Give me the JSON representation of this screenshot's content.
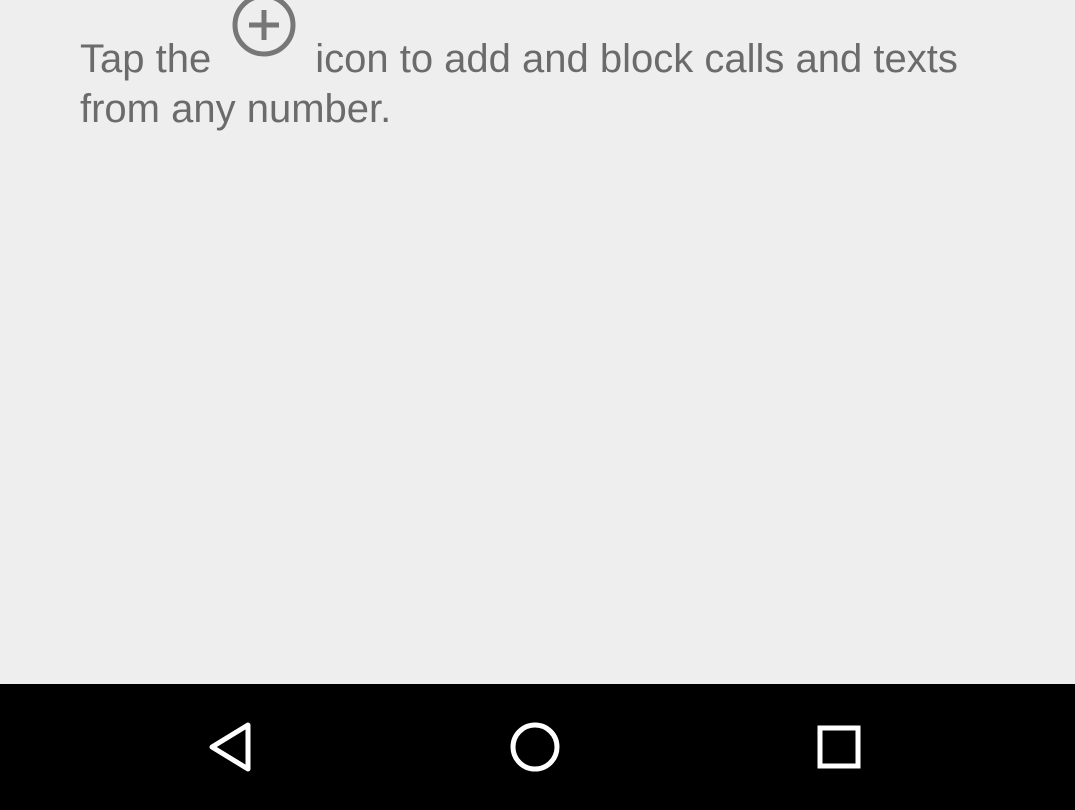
{
  "empty_state": {
    "text_before_icon": "Tap the",
    "icon": "add-circle-icon",
    "text_after_icon": "icon to add and block calls and texts from any number."
  },
  "navbar": {
    "back": "back-icon",
    "home": "home-icon",
    "recents": "recents-icon"
  },
  "colors": {
    "background": "#eeeeee",
    "text": "#6b6b6b",
    "icon": "#777777",
    "navbar": "#000000",
    "navbar_icon": "#ffffff"
  }
}
